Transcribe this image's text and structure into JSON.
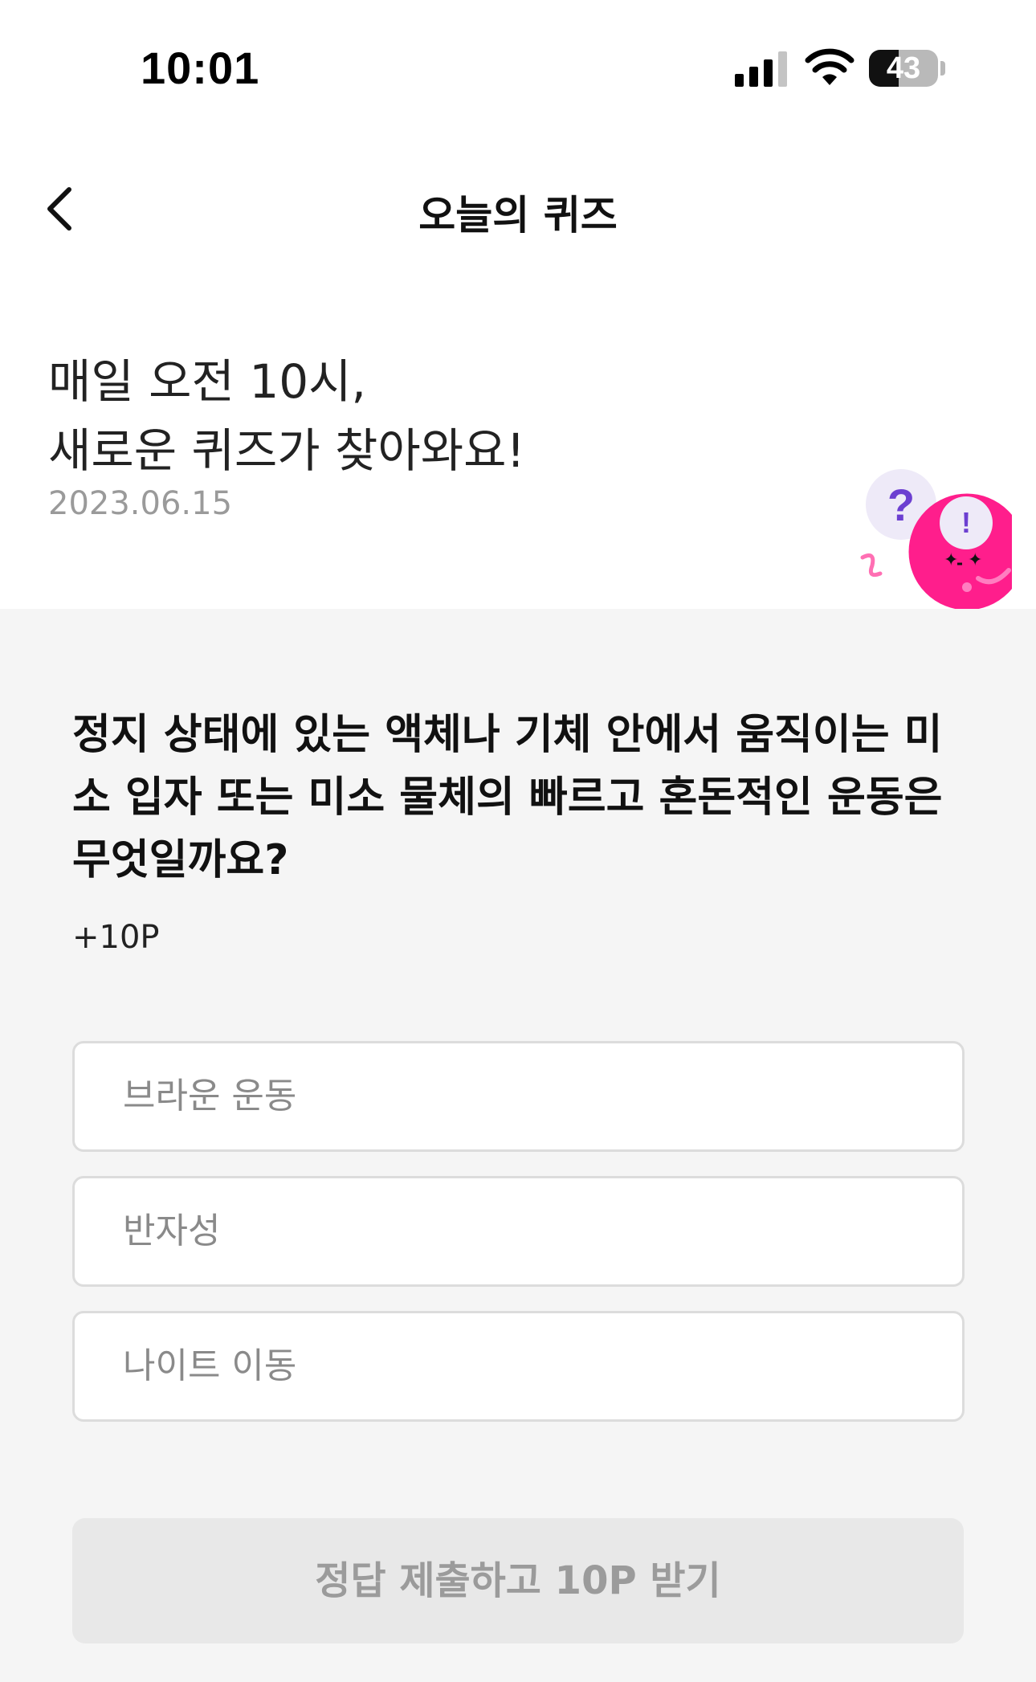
{
  "status_bar": {
    "time": "10:01",
    "battery": "43",
    "battery_level": 0.43
  },
  "nav": {
    "title": "오늘의 퀴즈",
    "back_icon": "chevron-left-icon"
  },
  "hero": {
    "title": "매일 오전 10시,\n새로운 퀴즈가 찾아와요!",
    "date": "2023.06.15",
    "mascot_question": "?",
    "mascot_exclaim": "!"
  },
  "quiz": {
    "question": "정지 상태에 있는 액체나 기체 안에서 움직이는 미소 입자 또는 미소 물체의 빠르고 혼돈적인 운동은 무엇일까요?",
    "points": "+10P",
    "options": [
      "브라운 운동",
      "반자성",
      "나이트 이동"
    ],
    "submit_label": "정답 제출하고 10P 받기"
  },
  "colors": {
    "accent": "#ff1e8c",
    "question_mark": "#6c3fd1",
    "submit_bg": "#e8e8e8"
  }
}
